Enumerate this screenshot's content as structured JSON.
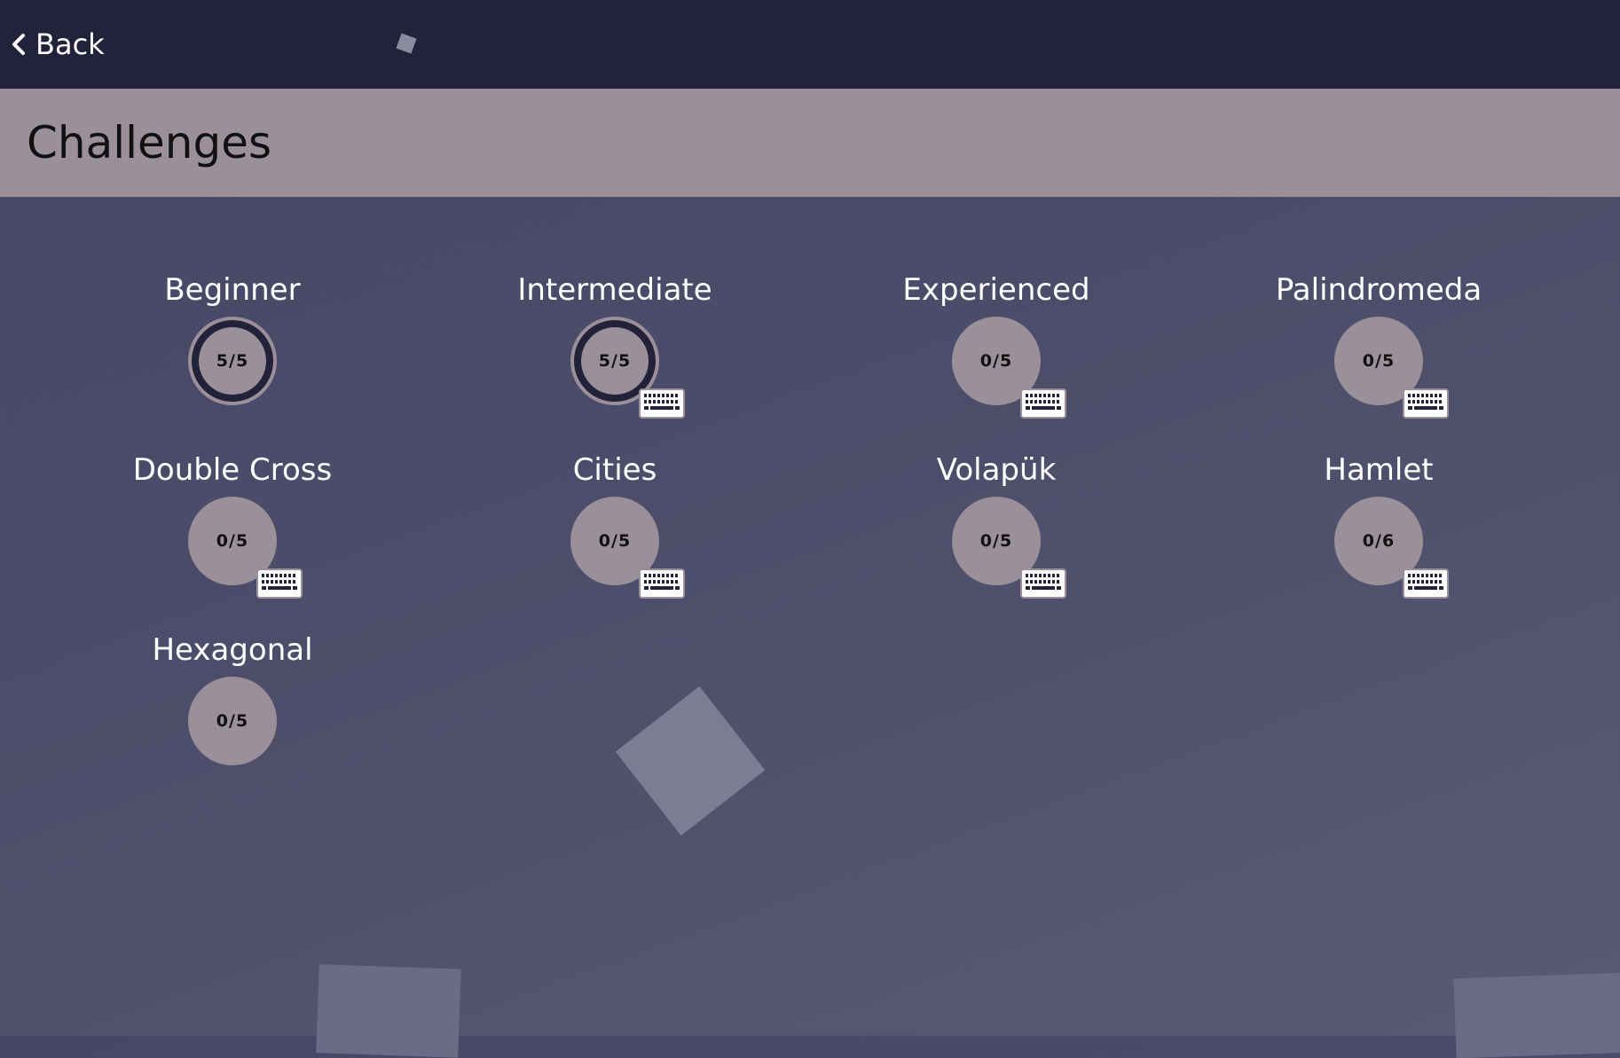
{
  "nav": {
    "back_label": "Back"
  },
  "header": {
    "title": "Challenges"
  },
  "challenges": [
    {
      "label": "Beginner",
      "progress": "5/5",
      "complete": true,
      "keyboard": false
    },
    {
      "label": "Intermediate",
      "progress": "5/5",
      "complete": true,
      "keyboard": true
    },
    {
      "label": "Experienced",
      "progress": "0/5",
      "complete": false,
      "keyboard": true
    },
    {
      "label": "Palindromeda",
      "progress": "0/5",
      "complete": false,
      "keyboard": true
    },
    {
      "label": "Double Cross",
      "progress": "0/5",
      "complete": false,
      "keyboard": true
    },
    {
      "label": "Cities",
      "progress": "0/5",
      "complete": false,
      "keyboard": true
    },
    {
      "label": "Volapük",
      "progress": "0/5",
      "complete": false,
      "keyboard": true
    },
    {
      "label": "Hamlet",
      "progress": "0/6",
      "complete": false,
      "keyboard": true
    },
    {
      "label": "Hexagonal",
      "progress": "0/5",
      "complete": false,
      "keyboard": false
    }
  ],
  "icons": {
    "back": "chevron-left-icon",
    "keyboard": "keyboard-icon"
  },
  "colors": {
    "topbar": "#22223a",
    "header": "#9b8f99",
    "background": "#4b4d6a",
    "circle": "#9b8f99",
    "complete_ring": "#22223a"
  }
}
